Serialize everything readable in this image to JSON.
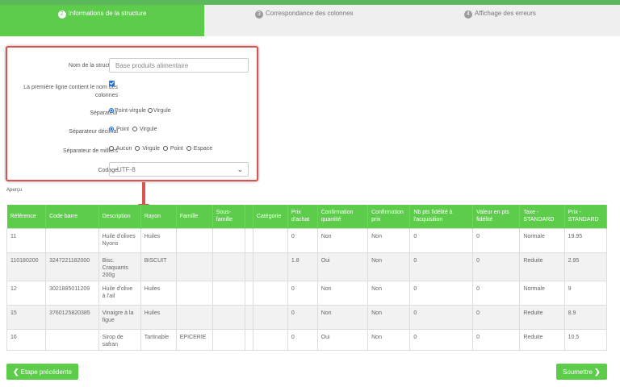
{
  "steps": [
    {
      "num": "2",
      "label": "Informations de la structure"
    },
    {
      "num": "3",
      "label": "Correspondance des colonnes"
    },
    {
      "num": "4",
      "label": "Affichage des erreurs"
    }
  ],
  "form": {
    "name_label": "Nom de la structure",
    "name_value": "Base produits alimentaire",
    "header_label": "La première ligne contient le nom des colonnes",
    "separator_label": "Séparateur",
    "separator_opt1": "Point-virgule",
    "separator_opt2": "Virgule",
    "decimal_label": "Séparateur décimal",
    "decimal_opt1": "Point",
    "decimal_opt2": "Virgule",
    "thousands_label": "Séparateur de milliers",
    "thousands_opt1": "Aucun",
    "thousands_opt2": "Virgule",
    "thousands_opt3": "Point",
    "thousands_opt4": "Espace",
    "encoding_label": "Codage",
    "encoding_value": "UTF-8"
  },
  "apercu": "Aperçu",
  "table": {
    "headers": [
      "Référence",
      "Code barre",
      "Description",
      "Rayon",
      "Famille",
      "Sous-famille",
      "",
      "Catégorie",
      "Prix d'achat",
      "Confirmation quantité",
      "Confirmation prix",
      "Nb pts fidélité à l'acquisition",
      "Valeur en pts fidélité",
      "Taxe - STANDARD",
      "Prix - STANDARD"
    ],
    "rows": [
      [
        "11",
        "",
        "Huile d'olives Nyons",
        "Huiles",
        "",
        "",
        "",
        "",
        "0",
        "Non",
        "Non",
        "0",
        "0",
        "Normale",
        "19.95"
      ],
      [
        "110180200",
        "3247221182000",
        "Bisc. Craquants 200g",
        "BISCUIT",
        "",
        "",
        "",
        "",
        "1.8",
        "Oui",
        "Non",
        "0",
        "0",
        "Reduite",
        "2.95"
      ],
      [
        "12",
        "3021885011209",
        "Huile d'olive à l'ail",
        "Huiles",
        "",
        "",
        "",
        "",
        "0",
        "Non",
        "Non",
        "0",
        "0",
        "Normale",
        "9"
      ],
      [
        "15",
        "3760125820385",
        "Vinaigre à la figue",
        "Huiles",
        "",
        "",
        "",
        "",
        "0",
        "Non",
        "Non",
        "0",
        "0",
        "Reduite",
        "8.9"
      ],
      [
        "16",
        "",
        "Sirop de safran",
        "Tartinable",
        "EPICERIE",
        "",
        "",
        "",
        "0",
        "Oui",
        "Non",
        "0",
        "0",
        "Reduite",
        "10.5"
      ]
    ]
  },
  "buttons": {
    "prev": "Etape précédente",
    "next": "Soumettre"
  },
  "colors": {
    "accent": "#5ccc4a",
    "highlight": "#d9534f"
  }
}
